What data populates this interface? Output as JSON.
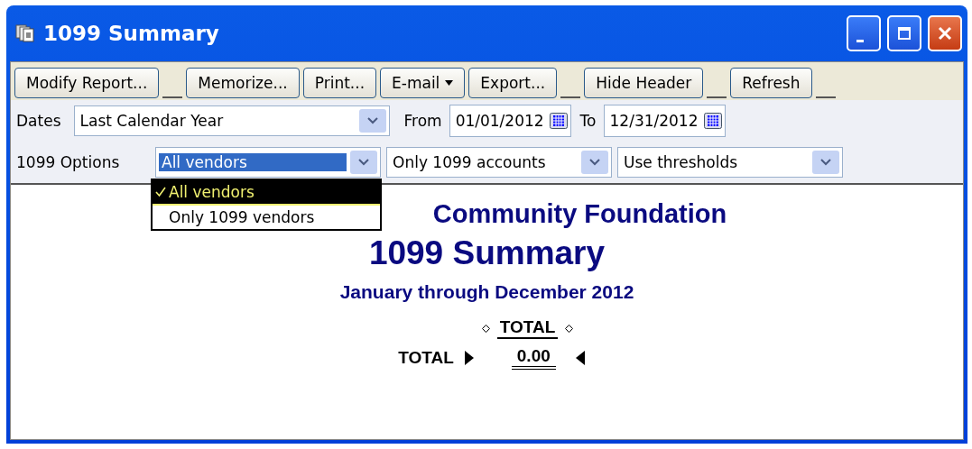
{
  "window": {
    "title": "1099 Summary"
  },
  "toolbar": [
    {
      "label": "Modify Report...",
      "kind": "button",
      "gap_after": true
    },
    {
      "label": "Memorize...",
      "kind": "button",
      "gap_after": false
    },
    {
      "label": "Print...",
      "kind": "button",
      "gap_after": false
    },
    {
      "label": "E-mail",
      "kind": "menu",
      "gap_after": false
    },
    {
      "label": "Export...",
      "kind": "button",
      "gap_after": true
    },
    {
      "label": "Hide Header",
      "kind": "button",
      "gap_after": true
    },
    {
      "label": "Refresh",
      "kind": "button",
      "gap_after": true
    }
  ],
  "dates": {
    "label": "Dates",
    "value": "Last Calendar Year",
    "from_label": "From",
    "from": "01/01/2012",
    "to_label": "To",
    "to": "12/31/2012"
  },
  "options": {
    "label": "1099 Options",
    "vendor_filter": "All vendors",
    "account_filter": "Only 1099 accounts",
    "threshold": "Use thresholds"
  },
  "vendor_menu": [
    {
      "label": "All vendors",
      "selected": true
    },
    {
      "label": "Only 1099 vendors",
      "selected": false
    }
  ],
  "report": {
    "company": "Community Foundation",
    "title": "1099 Summary",
    "period": "January through December 2012",
    "column": "TOTAL",
    "row_label": "TOTAL",
    "row_value": "0.00"
  }
}
